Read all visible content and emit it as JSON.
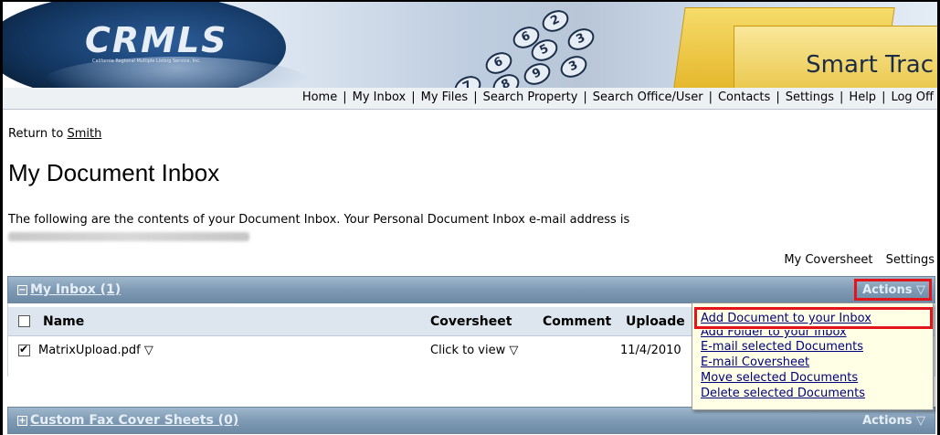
{
  "banner": {
    "logo_text": "CRMLS",
    "logo_subtitle": "California Regional Multiple Listing Service, Inc.",
    "brand": "Smart Trac",
    "keypad_digits": [
      "2",
      "3",
      "5",
      "6",
      "3",
      "9",
      "8",
      "6",
      "7"
    ]
  },
  "nav": {
    "items": [
      "Home",
      "My Inbox",
      "My Files",
      "Search Property",
      "Search Office/User",
      "Contacts",
      "Settings",
      "Help",
      "Log Off"
    ],
    "separator": "|"
  },
  "return": {
    "prefix": "Return to ",
    "link": "Smith"
  },
  "page": {
    "title": "My Document Inbox",
    "intro": "The following are the contents of your Document Inbox. Your Personal Document Inbox e-mail address is"
  },
  "utility_links": {
    "coversheet": "My Coversheet",
    "settings": "Settings"
  },
  "inbox_panel": {
    "toggle": "−",
    "title": "My Inbox (1)",
    "actions_label": "Actions ▽",
    "columns": {
      "name": "Name",
      "coversheet": "Coversheet",
      "comment": "Comment",
      "uploaded": "Uploade"
    },
    "rows": [
      {
        "checked": true,
        "name": "MatrixUpload.pdf ▽",
        "coversheet": "Click to view ▽",
        "comment": "",
        "uploaded": "11/4/2010"
      }
    ]
  },
  "actions_menu": {
    "items": [
      "Add Document to your Inbox",
      "Add Folder to your Inbox",
      "E-mail selected Documents",
      "E-mail Coversheet",
      "Move selected Documents",
      "Delete selected Documents"
    ]
  },
  "fax_panel": {
    "toggle": "+",
    "title": "Custom Fax Cover Sheets (0)",
    "actions_label": "Actions ▽"
  },
  "colors": {
    "panel_header": "#7e9ab4",
    "highlight_box": "#e4141b",
    "menu_bg": "#ffffe6",
    "menu_link": "#00007a"
  }
}
